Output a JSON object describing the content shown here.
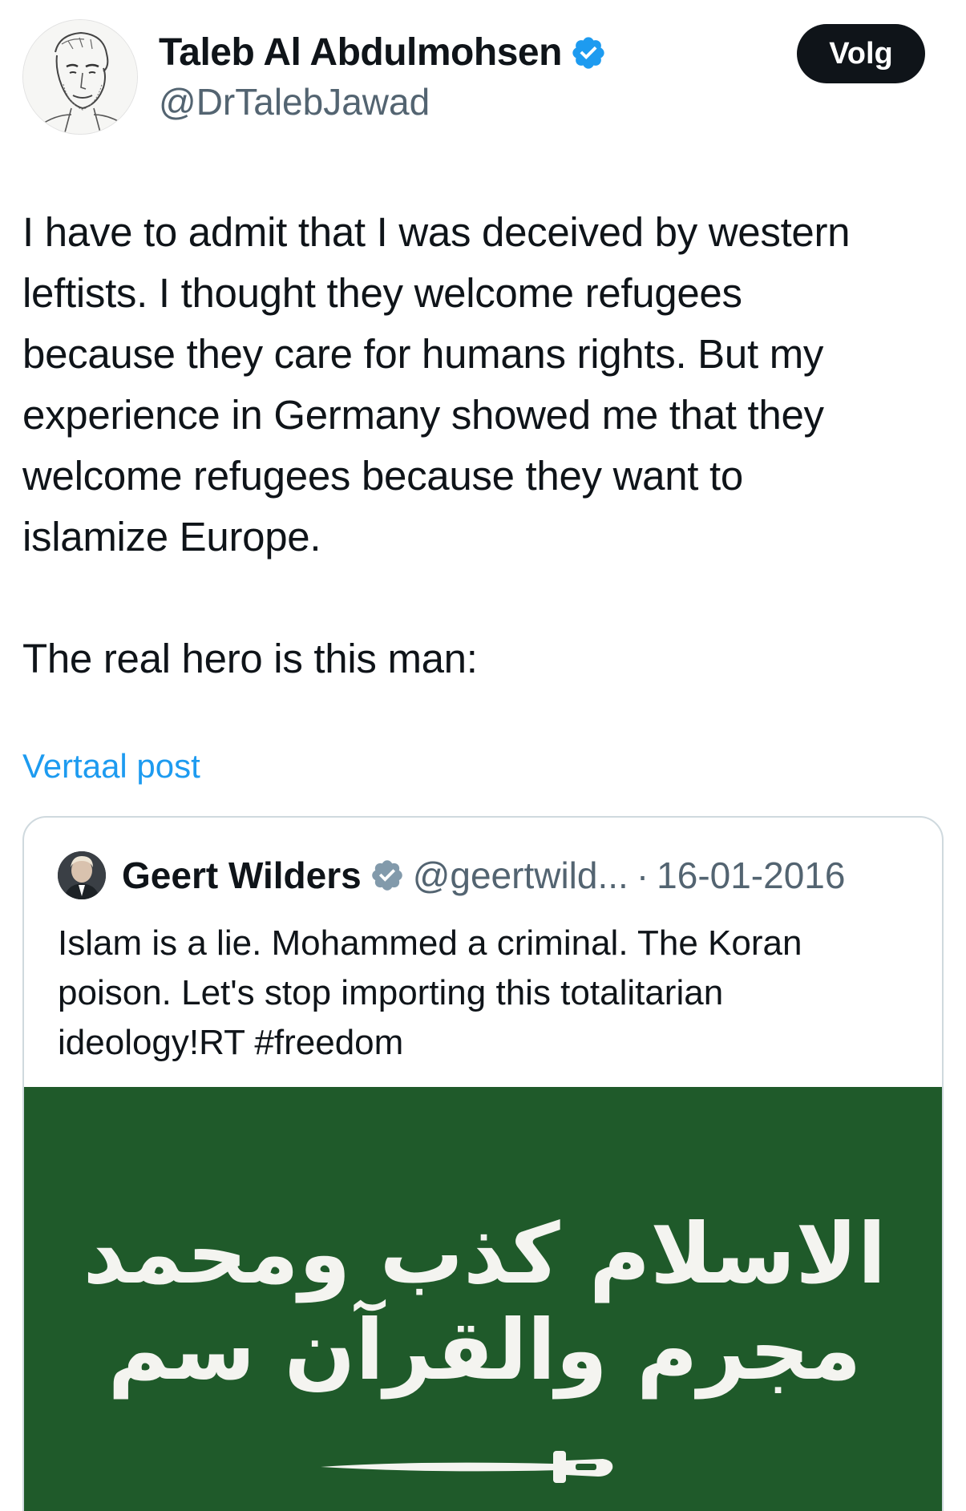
{
  "author": {
    "display_name": "Taleb Al Abdulmohsen",
    "handle": "@DrTalebJawad",
    "verified": true
  },
  "follow_label": "Volg",
  "post": {
    "paragraph_1": "I have to admit that I was deceived by western\nleftists. I thought they welcome refugees\nbecause they care for humans rights. But my\nexperience in Germany showed me that they\nwelcome refugees because they want to\nislamize Europe.",
    "paragraph_2": "The real hero is this man:"
  },
  "translate_label": "Vertaal post",
  "quote": {
    "display_name": "Geert Wilders",
    "handle": "@geertwild...",
    "separator": "·",
    "date": "16-01-2016",
    "text": "Islam is a lie. Mohammed a criminal. The Koran\npoison. Let's stop importing this totalitarian\nideology!RT  #freedom",
    "media": {
      "background_color": "#1f5a2a",
      "arabic_text": "الاسلام كذب ومحمد مجرم والقرآن سم"
    }
  },
  "colors": {
    "link": "#1d9bf0",
    "verified_badge": "#1d9bf0",
    "quote_verified_badge": "#829aab",
    "follow_button_bg": "#0f1419"
  }
}
